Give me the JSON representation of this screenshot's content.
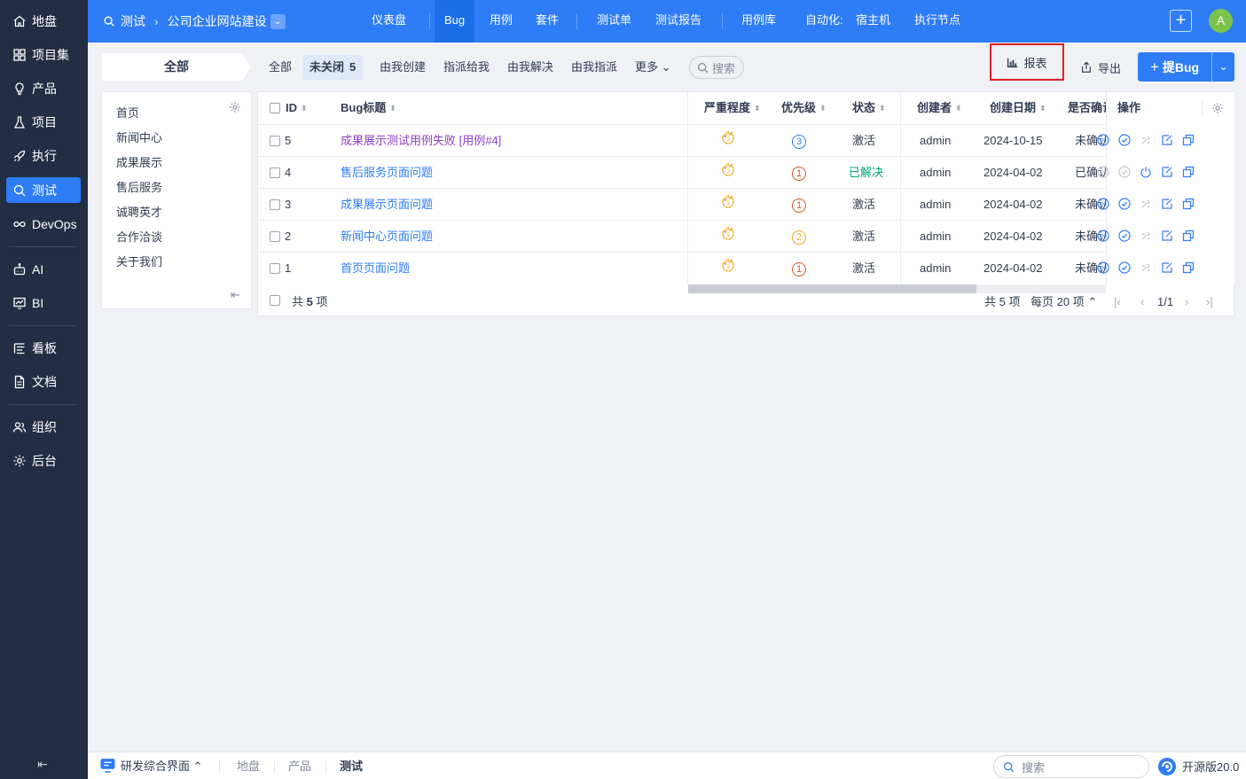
{
  "sidebar": {
    "items": [
      {
        "label": "地盘",
        "icon": "home-icon"
      },
      {
        "label": "项目集",
        "icon": "grid-icon"
      },
      {
        "label": "产品",
        "icon": "lightbulb-icon"
      },
      {
        "label": "项目",
        "icon": "flask-icon"
      },
      {
        "label": "执行",
        "icon": "rocket-icon"
      },
      {
        "label": "测试",
        "icon": "search-bug-icon"
      },
      {
        "label": "DevOps",
        "icon": "infinity-icon"
      },
      {
        "label": "AI",
        "icon": "robot-icon"
      },
      {
        "label": "BI",
        "icon": "chart-icon"
      },
      {
        "label": "看板",
        "icon": "kanban-icon"
      },
      {
        "label": "文档",
        "icon": "document-icon"
      },
      {
        "label": "组织",
        "icon": "people-icon"
      },
      {
        "label": "后台",
        "icon": "gear-icon"
      }
    ],
    "active_index": 5,
    "collapse_glyph": "⇤"
  },
  "header": {
    "module": "测试",
    "arrow": "›",
    "product": "公司企业网站建设",
    "dropdown_glyph": "⌄",
    "nav": [
      {
        "label": "仪表盘"
      },
      {
        "label": "Bug"
      },
      {
        "label": "用例"
      },
      {
        "label": "套件"
      },
      {
        "label": "测试单"
      },
      {
        "label": "测试报告"
      },
      {
        "label": "用例库"
      },
      {
        "label": "自动化:"
      },
      {
        "label": "宿主机"
      },
      {
        "label": "执行节点"
      }
    ],
    "active_nav": 1,
    "plus_glyph": "+",
    "avatar_initial": "A"
  },
  "featurebar": {
    "module_tab": "全部",
    "tabs": [
      {
        "label": "全部"
      },
      {
        "label": "未关闭",
        "count": "5"
      },
      {
        "label": "由我创建"
      },
      {
        "label": "指派给我"
      },
      {
        "label": "由我解决"
      },
      {
        "label": "由我指派"
      },
      {
        "label": "更多 ⌄"
      }
    ],
    "search_label": "搜索",
    "report_label": "报表",
    "export_label": "导出",
    "create_bug_label": "提Bug",
    "create_bug_plus": "+",
    "split_glyph": "⌄"
  },
  "tree": {
    "items": [
      "首页",
      "新闻中心",
      "成果展示",
      "售后服务",
      "诚聘英才",
      "合作洽谈",
      "关于我们"
    ],
    "collapse_glyph": "⇤"
  },
  "table": {
    "headers": {
      "id": "ID",
      "title": "Bug标题",
      "severity": "严重程度",
      "priority": "优先级",
      "status": "状态",
      "creator": "创建者",
      "created": "创建日期",
      "confirmed": "是否确认",
      "actions": "操作"
    },
    "sort_glyph": "⬍",
    "rows": [
      {
        "id": "5",
        "title": "成果展示测试用例失败 [用例#4]",
        "visited": true,
        "severity": "3",
        "priority": "3",
        "status": "激活",
        "creator": "admin",
        "created": "2024-10-15",
        "confirmed": "未确认",
        "resolved": false
      },
      {
        "id": "4",
        "title": "售后服务页面问题",
        "visited": false,
        "severity": "3",
        "priority": "1",
        "status": "已解决",
        "creator": "admin",
        "created": "2024-04-02",
        "confirmed": "已确认",
        "resolved": true
      },
      {
        "id": "3",
        "title": "成果展示页面问题",
        "visited": false,
        "severity": "3",
        "priority": "1",
        "status": "激活",
        "creator": "admin",
        "created": "2024-04-02",
        "confirmed": "未确认",
        "resolved": false
      },
      {
        "id": "2",
        "title": "新闻中心页面问题",
        "visited": false,
        "severity": "3",
        "priority": "2",
        "status": "激活",
        "creator": "admin",
        "created": "2024-04-02",
        "confirmed": "未确认",
        "resolved": false
      },
      {
        "id": "1",
        "title": "首页页面问题",
        "visited": false,
        "severity": "3",
        "priority": "1",
        "status": "激活",
        "creator": "admin",
        "created": "2024-04-02",
        "confirmed": "未确认",
        "resolved": false
      }
    ],
    "footer": {
      "total_prefix": "共",
      "total_count": "5",
      "total_suffix": "项",
      "summary": "共 5 项",
      "per_page": "每页 20 项",
      "per_page_glyph": "⌃",
      "page": "1/1",
      "first_glyph": "|‹",
      "prev_glyph": "‹",
      "next_glyph": "›",
      "last_glyph": "›|"
    }
  },
  "bottombar": {
    "app_label": "研发综合界面",
    "app_glyph": "⌃",
    "crumbs": [
      "地盘",
      "产品",
      "测试"
    ],
    "search_placeholder": "搜索",
    "version": "开源版20.0"
  },
  "colors": {
    "primary": "#2e7cf6",
    "sidebar": "#232d43",
    "severity": "#f5a623",
    "priority_1": "#e0521e",
    "priority_2": "#f5a623",
    "priority_3": "#2e7cf6",
    "resolved": "#00a86b",
    "highlight": "#e02020"
  }
}
